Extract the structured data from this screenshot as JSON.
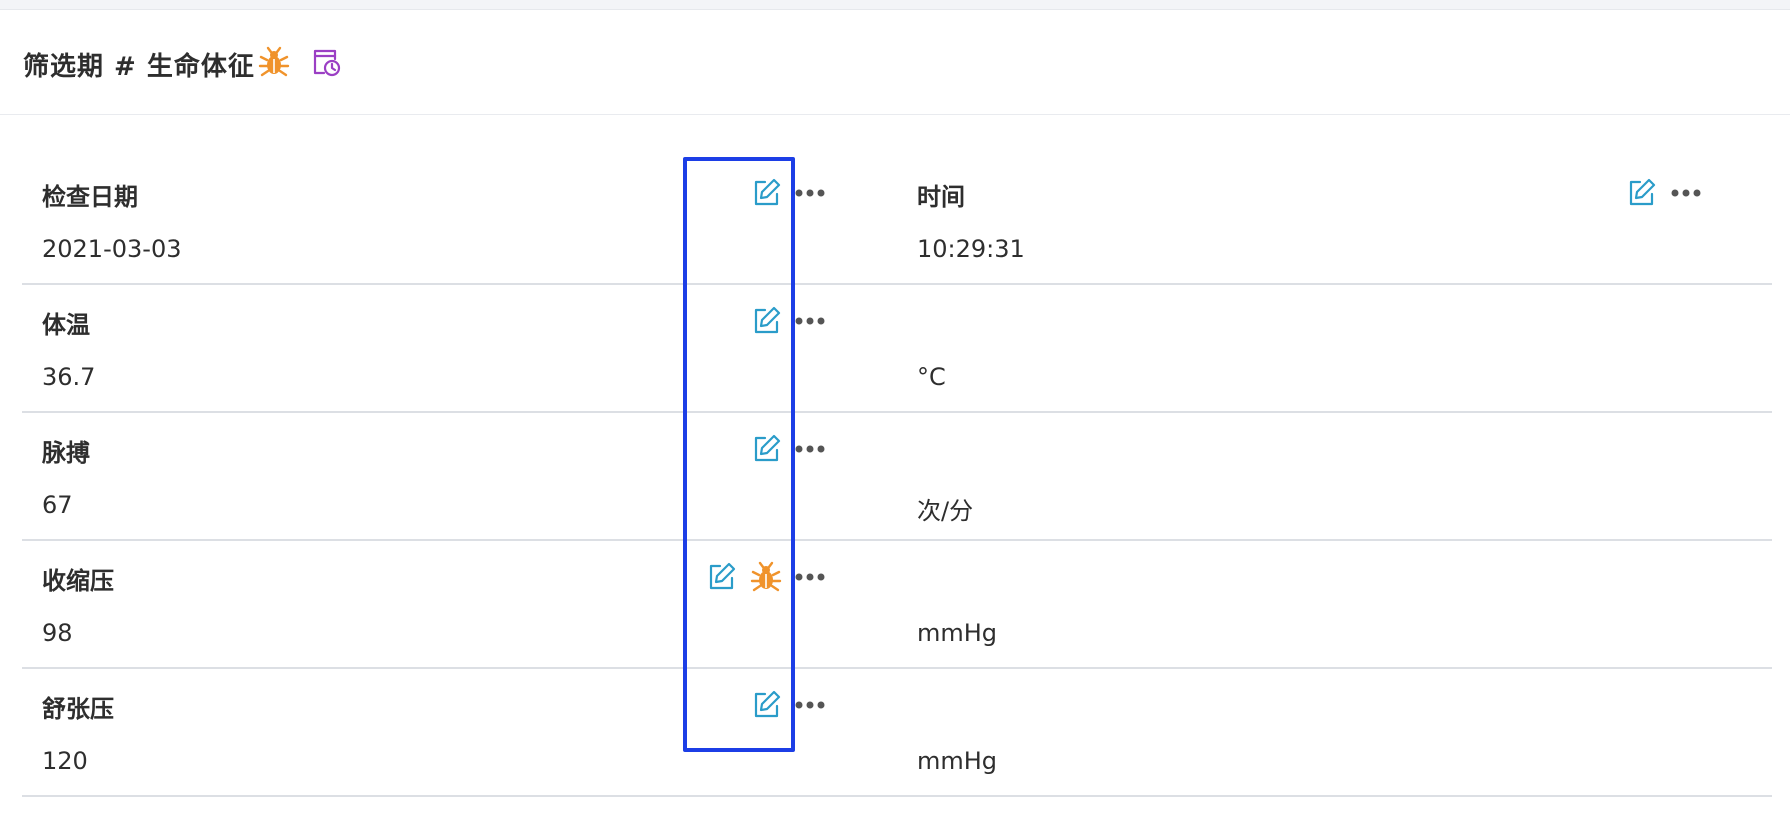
{
  "header": {
    "title": "筛选期 # 生命体征",
    "icons": [
      "bug-icon",
      "history-icon"
    ]
  },
  "rows": [
    {
      "label": "检查日期",
      "value": "2021-03-03",
      "right_label": "时间",
      "right_value": "10:29:31"
    },
    {
      "label": "体温",
      "value": "36.7",
      "unit": "°C"
    },
    {
      "label": "脉搏",
      "value": "67",
      "unit": "次/分"
    },
    {
      "label": "收缩压",
      "value": "98",
      "unit": "mmHg",
      "has_issue": true
    },
    {
      "label": "舒张压",
      "value": "120",
      "unit": "mmHg"
    }
  ],
  "colors": {
    "edit_icon": "#2a9cc9",
    "bug_icon": "#f0932b",
    "history_icon": "#9b3fc4",
    "highlight": "#1c3ee6"
  }
}
